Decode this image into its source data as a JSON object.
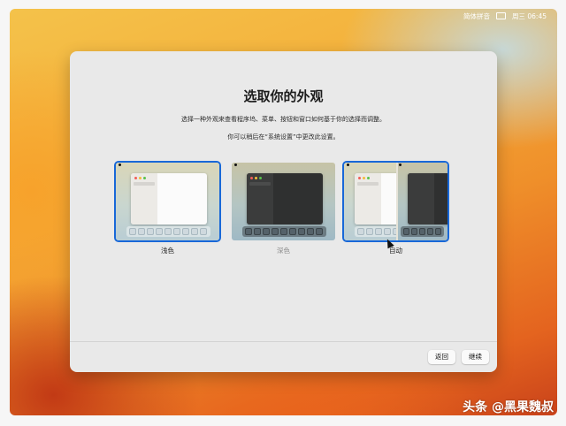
{
  "menubar": {
    "input_method": "简体拼音",
    "clock": "周三 06:45"
  },
  "dialog": {
    "title": "选取你的外观",
    "description": "选择一种外观来查看程序坞、菜单、按钮和窗口如何基于你的选择而调整。",
    "description2": "你可以稍后在“系统设置”中更改此设置。",
    "options": [
      {
        "label": "浅色",
        "selected": true
      },
      {
        "label": "深色",
        "selected": false
      },
      {
        "label": "自动",
        "selected": true
      }
    ],
    "back_button": "返回",
    "continue_button": "继续"
  },
  "watermark": "头条 @黑果魏叔",
  "icons": [
    "keyboard-icon",
    "mouse-cursor-icon"
  ],
  "colors": {
    "selection_accent": "#1868d8",
    "dialog_bg": "#e9e9e9"
  }
}
